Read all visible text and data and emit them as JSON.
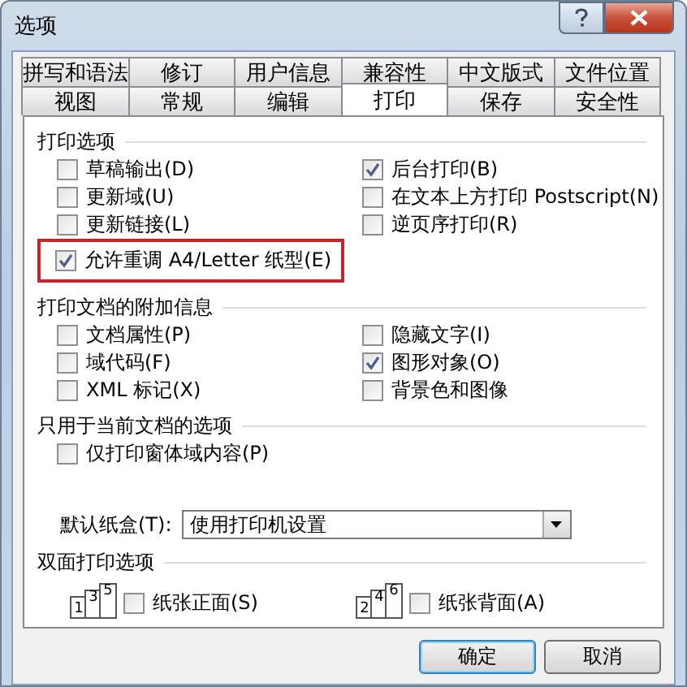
{
  "window": {
    "title": "选项"
  },
  "tab_rows": [
    {
      "tabs": [
        {
          "label": "拼写和语法",
          "selected": false
        },
        {
          "label": "修订",
          "selected": false
        },
        {
          "label": "用户信息",
          "selected": false
        },
        {
          "label": "兼容性",
          "selected": false
        },
        {
          "label": "中文版式",
          "selected": false
        },
        {
          "label": "文件位置",
          "selected": false
        }
      ]
    },
    {
      "tabs": [
        {
          "label": "视图",
          "selected": false
        },
        {
          "label": "常规",
          "selected": false
        },
        {
          "label": "编辑",
          "selected": false
        },
        {
          "label": "打印",
          "selected": true
        },
        {
          "label": "保存",
          "selected": false
        },
        {
          "label": "安全性",
          "selected": false
        }
      ]
    }
  ],
  "print_options": {
    "title": "打印选项",
    "left": [
      {
        "label": "草稿输出(D)",
        "checked": false,
        "highlighted": false
      },
      {
        "label": "更新域(U)",
        "checked": false,
        "highlighted": false
      },
      {
        "label": "更新链接(L)",
        "checked": false,
        "highlighted": false
      },
      {
        "label": "允许重调 A4/Letter 纸型(E)",
        "checked": true,
        "highlighted": true
      }
    ],
    "right": [
      {
        "label": "后台打印(B)",
        "checked": true,
        "highlighted": false
      },
      {
        "label": "在文本上方打印 Postscript(N)",
        "checked": false,
        "highlighted": false
      },
      {
        "label": "逆页序打印(R)",
        "checked": false,
        "highlighted": false
      }
    ]
  },
  "attached_info": {
    "title": "打印文档的附加信息",
    "left": [
      {
        "label": "文档属性(P)",
        "checked": false,
        "highlighted": false
      },
      {
        "label": "域代码(F)",
        "checked": false,
        "highlighted": false
      },
      {
        "label": "XML 标记(X)",
        "checked": false,
        "highlighted": false
      }
    ],
    "right": [
      {
        "label": "隐藏文字(I)",
        "checked": false,
        "highlighted": false
      },
      {
        "label": "图形对象(O)",
        "checked": true,
        "highlighted": false
      },
      {
        "label": "背景色和图像",
        "checked": false,
        "highlighted": false
      }
    ]
  },
  "current_doc": {
    "title": "只用于当前文档的选项",
    "options": [
      {
        "label": "仅打印窗体域内容(P)",
        "checked": false,
        "highlighted": false
      }
    ]
  },
  "default_tray": {
    "label": "默认纸盒(T):",
    "value": "使用打印机设置"
  },
  "duplex": {
    "title": "双面打印选项",
    "items": [
      {
        "pages": [
          "1",
          "3",
          "5"
        ],
        "label": "纸张正面(S)",
        "checked": false
      },
      {
        "pages": [
          "2",
          "4",
          "6"
        ],
        "label": "纸张背面(A)",
        "checked": false
      }
    ]
  },
  "buttons": [
    {
      "label": "确定",
      "default": true
    },
    {
      "label": "取消",
      "default": false
    }
  ]
}
